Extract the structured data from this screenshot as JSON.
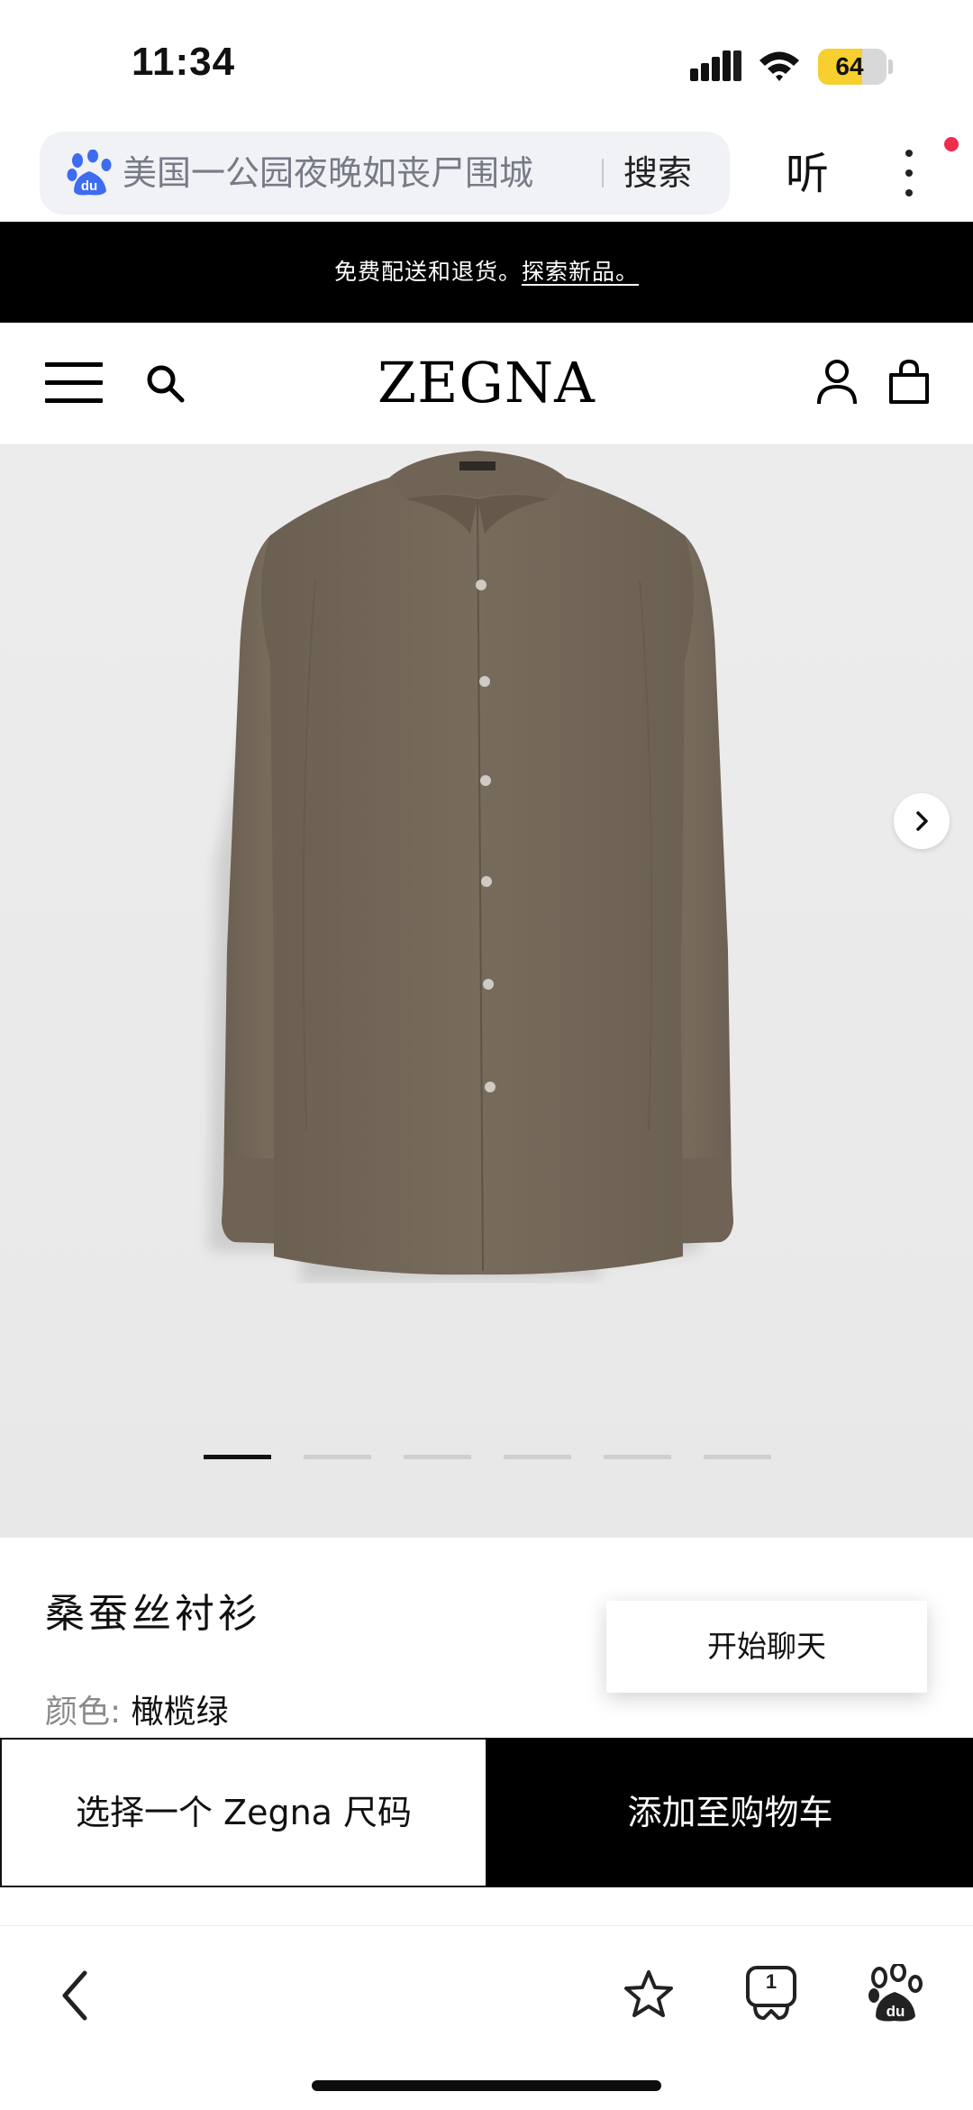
{
  "status_bar": {
    "time": "11:34",
    "battery_level": "64",
    "battery_fraction": 0.64,
    "battery_color": "#f7cf2e"
  },
  "browser": {
    "search_query": "美国一公园夜晚如丧尸围城",
    "search_button": "搜索",
    "listen_button": "听",
    "tab_count": "1",
    "icons": {
      "search_bar": "baidu-paw-icon",
      "more": "more-vertical-icon",
      "back": "chevron-left-icon",
      "favorite": "star-icon",
      "tabs": "tabs-icon",
      "home": "baidu-home-icon"
    }
  },
  "promo": {
    "text": "免费配送和退货。",
    "link": "探索新品。"
  },
  "header": {
    "logo": "ZEGNA",
    "icons": {
      "menu": "hamburger-menu-icon",
      "search": "search-icon",
      "account": "account-icon",
      "bag": "shopping-bag-icon"
    }
  },
  "gallery": {
    "image": "olive-silk-shirt-image",
    "slide_count": 6,
    "active_slide": 1,
    "next_icon": "chevron-right-icon"
  },
  "product": {
    "title": "桑蚕丝衬衫",
    "color_label": "颜色:",
    "color_value": "橄榄绿",
    "shirt_color": "#75695a"
  },
  "chat": {
    "label": "开始聊天"
  },
  "actions": {
    "size_label": "选择一个 Zegna 尺码",
    "cart_label": "添加至购物车"
  }
}
